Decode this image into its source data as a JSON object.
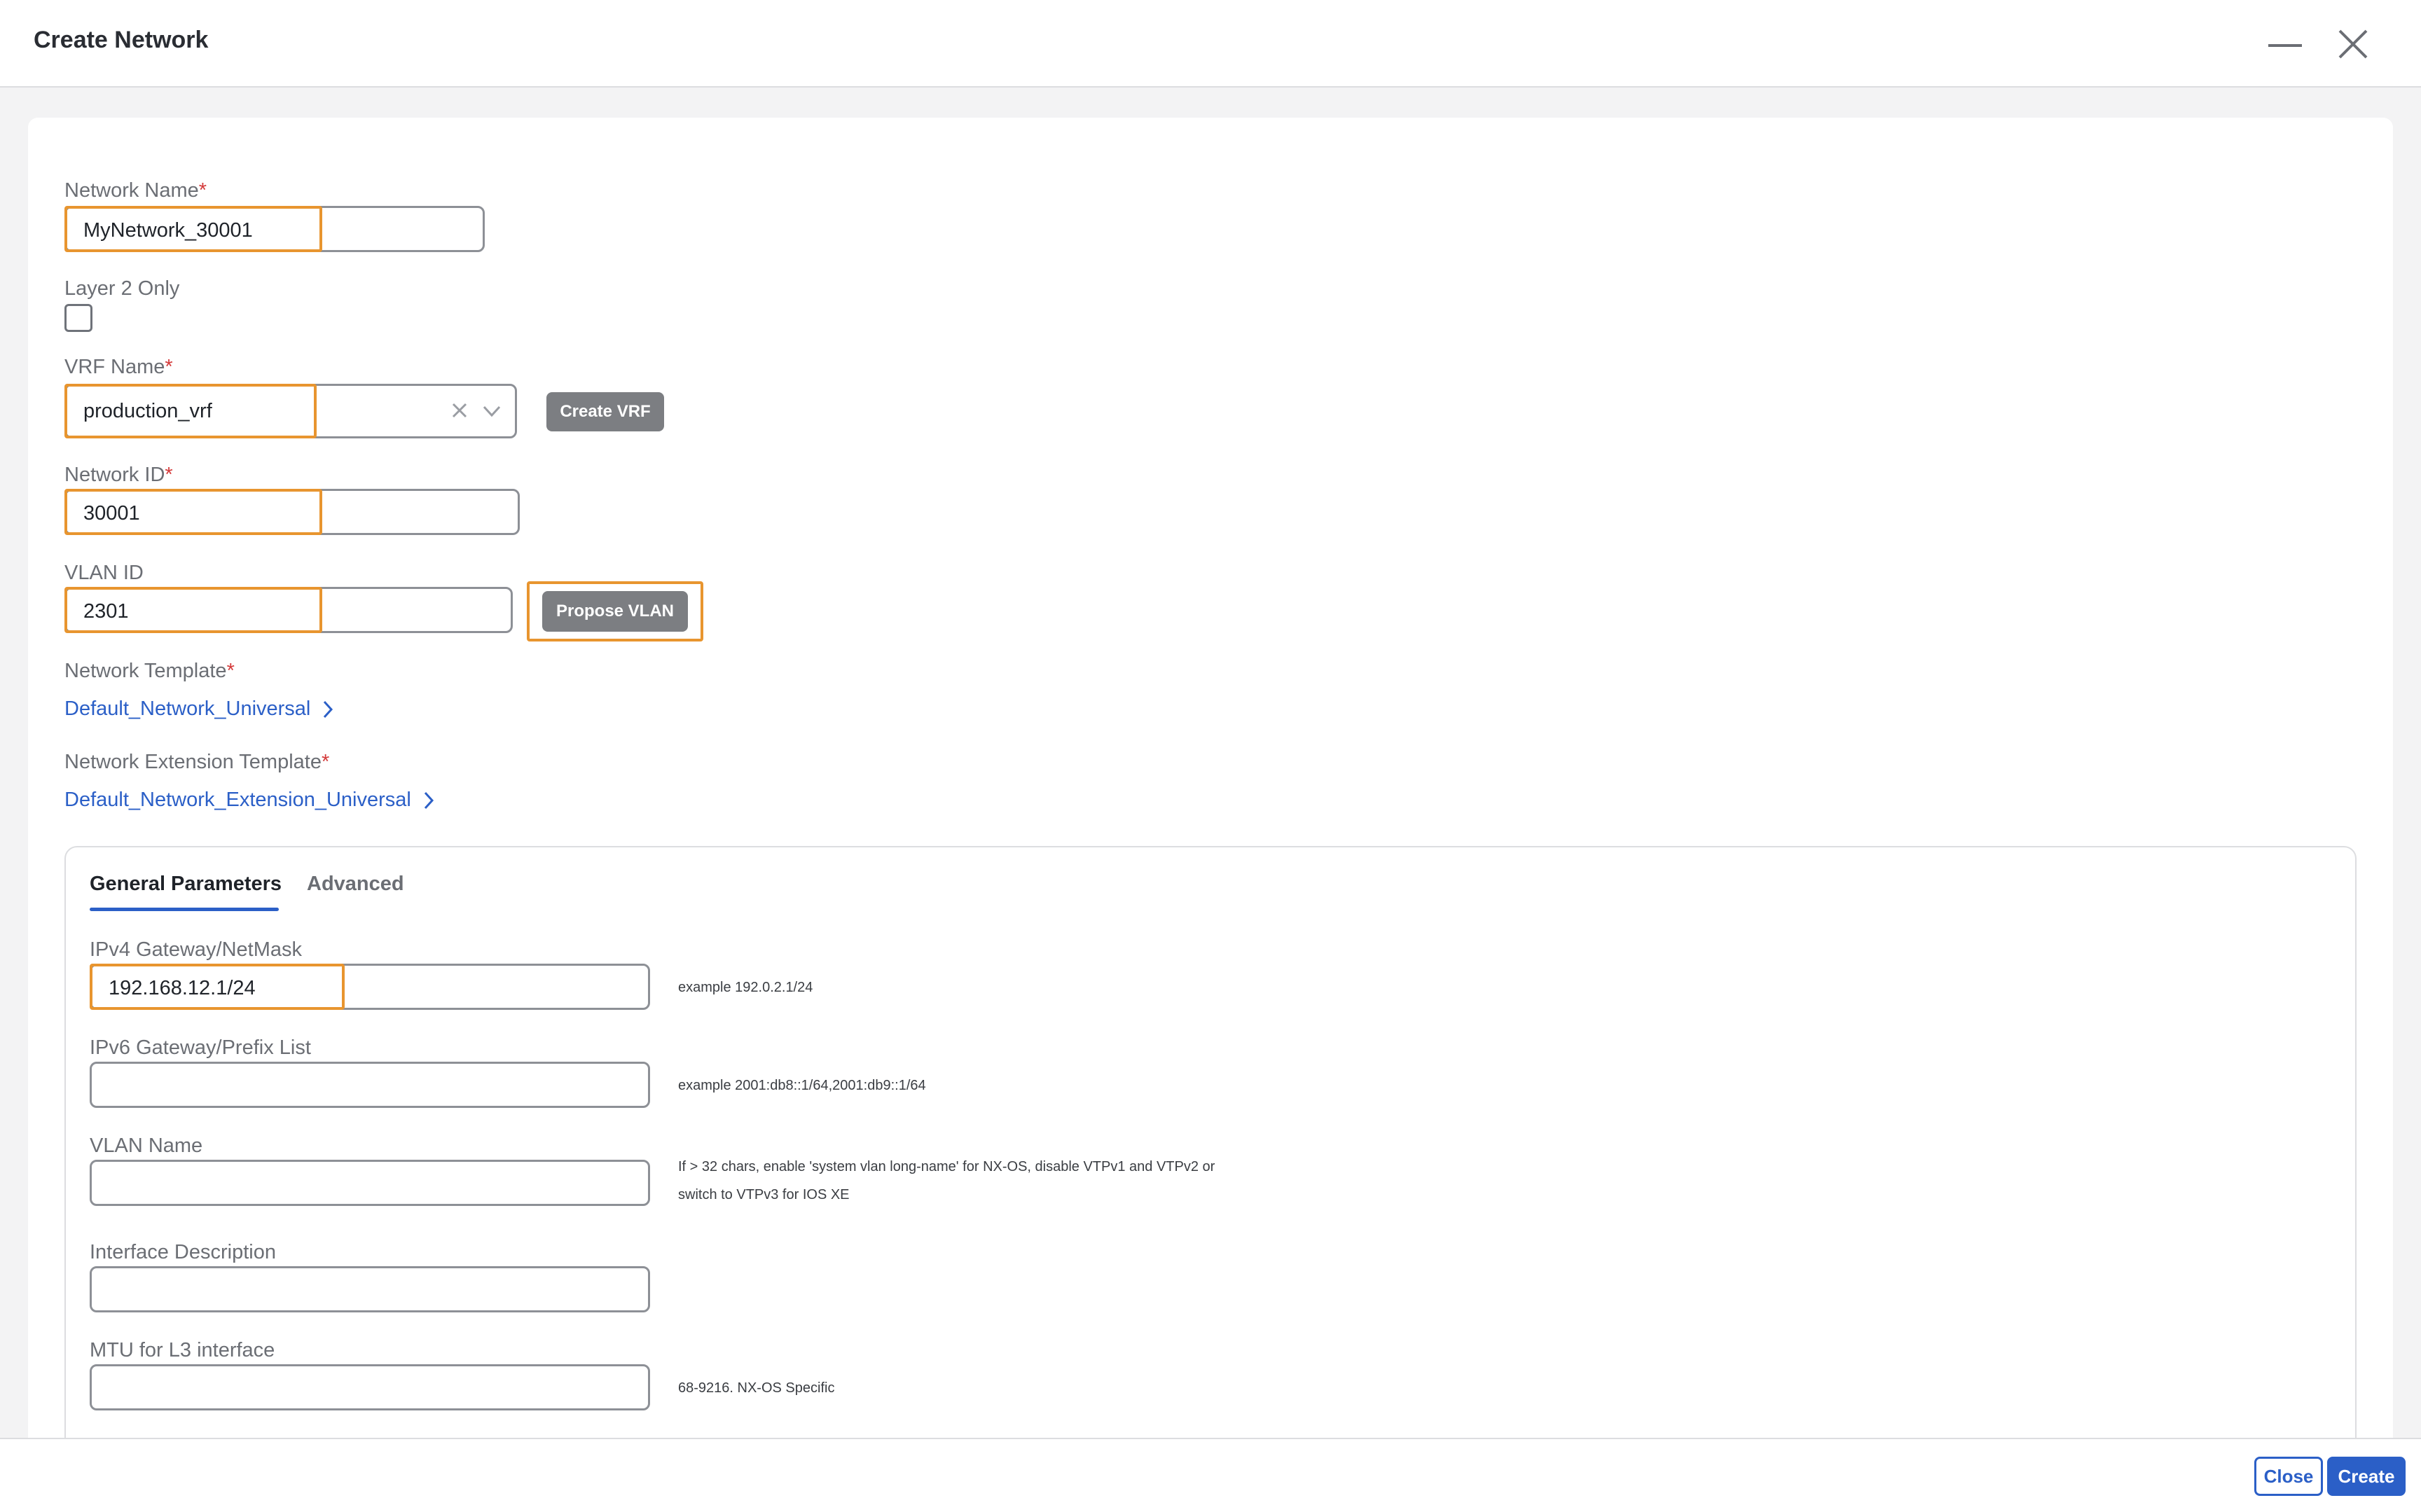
{
  "header": {
    "title": "Create Network",
    "minimize_icon": "minimize-icon",
    "close_icon": "close-icon"
  },
  "form": {
    "network_name": {
      "label": "Network Name",
      "required": "*",
      "value": "MyNetwork_30001"
    },
    "layer2_only": {
      "label": "Layer 2 Only",
      "checked": false
    },
    "vrf_name": {
      "label": "VRF Name",
      "required": "*",
      "value": "production_vrf",
      "create_button": "Create VRF"
    },
    "network_id": {
      "label": "Network ID",
      "required": "*",
      "value": "30001"
    },
    "vlan_id": {
      "label": "VLAN ID",
      "value": "2301",
      "propose_button": "Propose VLAN"
    },
    "network_template": {
      "label": "Network Template",
      "required": "*",
      "value": "Default_Network_Universal"
    },
    "network_extension_template": {
      "label": "Network Extension Template",
      "required": "*",
      "value": "Default_Network_Extension_Universal"
    }
  },
  "tabs": [
    {
      "label": "General Parameters",
      "active": true
    },
    {
      "label": "Advanced",
      "active": false
    }
  ],
  "general": {
    "ipv4": {
      "label": "IPv4 Gateway/NetMask",
      "value": "192.168.12.1/24",
      "hint": "example 192.0.2.1/24"
    },
    "ipv6": {
      "label": "IPv6 Gateway/Prefix List",
      "value": "",
      "hint": "example 2001:db8::1/64,2001:db9::1/64"
    },
    "vlan_name": {
      "label": "VLAN Name",
      "value": "",
      "hint_line1": "If > 32 chars, enable 'system vlan long-name' for NX-OS, disable VTPv1 and VTPv2 or",
      "hint_line2": "switch to VTPv3 for IOS XE"
    },
    "interface_description": {
      "label": "Interface Description",
      "value": ""
    },
    "mtu": {
      "label": "MTU for L3 interface",
      "value": "",
      "hint": "68-9216. NX-OS Specific"
    }
  },
  "footer": {
    "close_label": "Close",
    "create_label": "Create"
  },
  "colors": {
    "accent": "#2b5fc7",
    "highlight": "#e8952f",
    "required": "#d43a3a",
    "button_gray": "#7c7e82"
  }
}
